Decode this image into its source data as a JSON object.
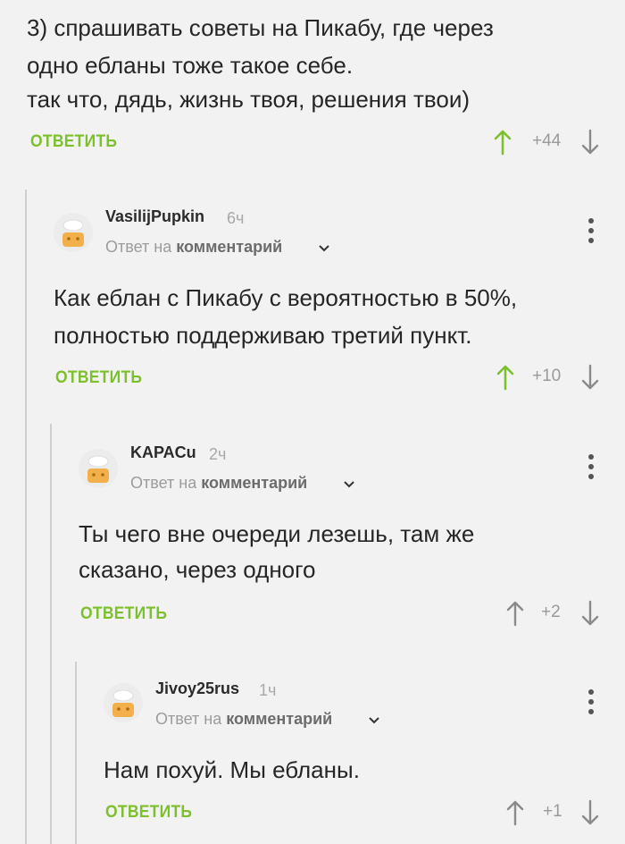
{
  "colors": {
    "accent": "#7cc02b",
    "text": "#262626",
    "muted": "#9c9c9c",
    "thread": "#cfcfcf"
  },
  "top_comment": {
    "lines": [
      "3) спрашивать советы на Пикабу, где через",
      "одно ебланы тоже такое себе.",
      "так что, дядь, жизнь твоя, решения твои)"
    ],
    "reply_label": "ОТВЕТИТЬ",
    "rating": "+44"
  },
  "comments": [
    {
      "username": "VasilijPupkin",
      "time": "6ч",
      "meta_prefix": "Ответ на",
      "meta_target": "комментарий",
      "lines": [
        "Как еблан с Пикабу с вероятностью в 50%,",
        "полностью поддерживаю третий пункт."
      ],
      "reply_label": "ОТВЕТИТЬ",
      "rating": "+10"
    },
    {
      "username": "KAPACu",
      "time": "2ч",
      "meta_prefix": "Ответ на",
      "meta_target": "комментарий",
      "lines": [
        "Ты чего вне очереди лезешь, там же",
        "сказано, через одного"
      ],
      "reply_label": "ОТВЕТИТЬ",
      "rating": "+2"
    },
    {
      "username": "Jivoy25rus",
      "time": "1ч",
      "meta_prefix": "Ответ на",
      "meta_target": "комментарий",
      "lines": [
        "Нам похуй. Мы ебланы."
      ],
      "reply_label": "ОТВЕТИТЬ",
      "rating": "+1"
    }
  ],
  "icons": {
    "upvote": "arrow-up-icon",
    "downvote": "arrow-down-icon",
    "more": "kebab-menu-icon",
    "expand": "chevron-down-icon",
    "avatar": "default-avatar-icon"
  }
}
